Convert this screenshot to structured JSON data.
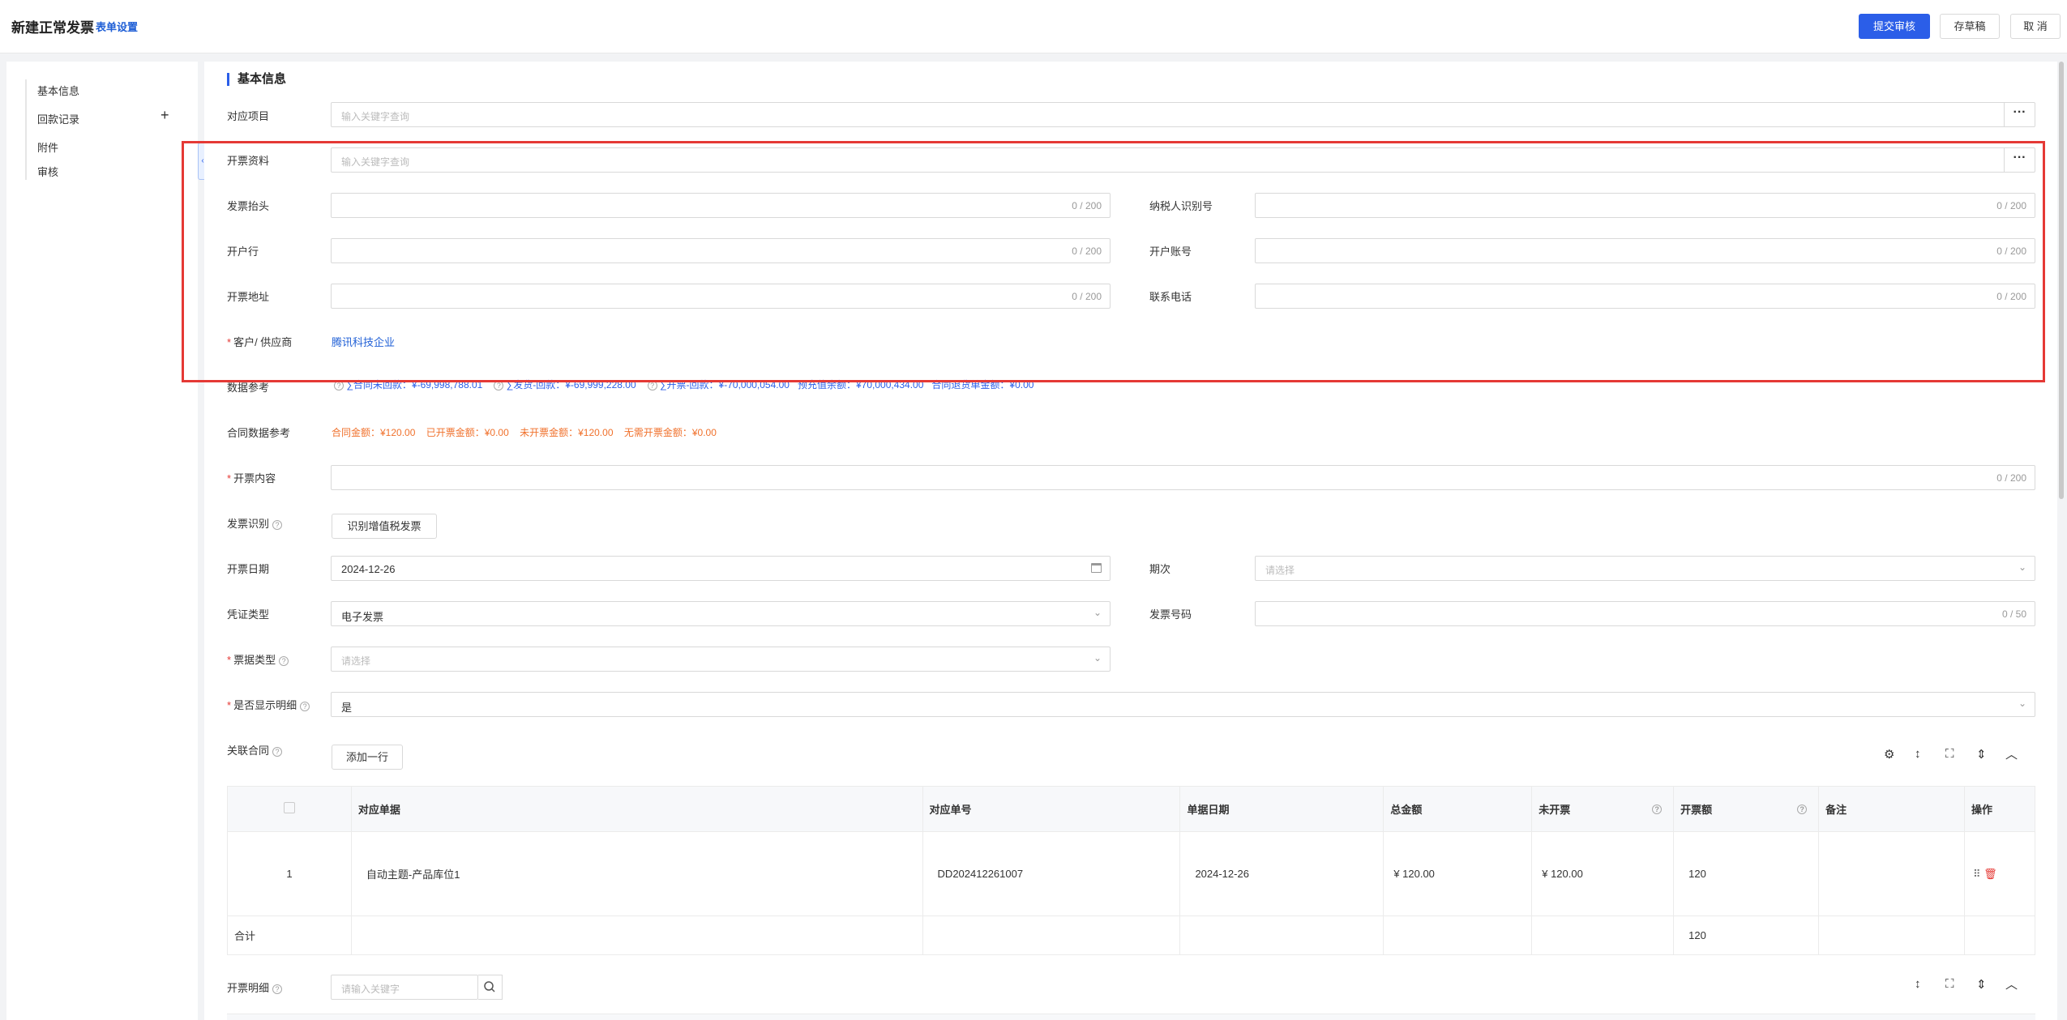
{
  "header": {
    "title": "新建正常发票",
    "form_settings": "表单设置",
    "submit": "提交审核",
    "draft": "存草稿",
    "cancel": "取 消"
  },
  "sidebar": {
    "items": [
      {
        "label": "基本信息"
      },
      {
        "label": "回款记录"
      },
      {
        "label": "附件"
      },
      {
        "label": "审核"
      }
    ]
  },
  "section": {
    "title": "基本信息"
  },
  "form": {
    "project": {
      "label": "对应项目",
      "placeholder": "输入关键字查询"
    },
    "invoice_info": {
      "label": "开票资料",
      "placeholder": "输入关键字查询"
    },
    "invoice_title": {
      "label": "发票抬头",
      "count": "0 / 200"
    },
    "taxpayer_id": {
      "label": "纳税人识别号",
      "count": "0 / 200"
    },
    "bank": {
      "label": "开户行",
      "count": "0 / 200"
    },
    "account": {
      "label": "开户账号",
      "count": "0 / 200"
    },
    "address": {
      "label": "开票地址",
      "count": "0 / 200"
    },
    "phone": {
      "label": "联系电话",
      "count": "0 / 200"
    },
    "customer": {
      "label": "客户/ 供应商",
      "value": "腾讯科技企业"
    },
    "data_ref": {
      "label": "数据参考",
      "items": [
        "∑合同未回款：¥-69,998,788.01",
        "∑发货-回款：¥-69,999,228.00",
        "∑开票-回款：¥-70,000,054.00",
        "预充值余额：¥70,000,434.00",
        "合同退货单金额：¥0.00"
      ]
    },
    "contract_ref": {
      "label": "合同数据参考",
      "items": [
        "合同金额：¥120.00",
        "已开票金额：¥0.00",
        "未开票金额：¥120.00",
        "无需开票金额：¥0.00"
      ]
    },
    "content": {
      "label": "开票内容",
      "count": "0 / 200"
    },
    "recognize": {
      "label": "发票识别",
      "button": "识别增值税发票"
    },
    "date": {
      "label": "开票日期",
      "value": "2024-12-26"
    },
    "period": {
      "label": "期次",
      "placeholder": "请选择"
    },
    "voucher_type": {
      "label": "凭证类型",
      "value": "电子发票"
    },
    "invoice_no": {
      "label": "发票号码",
      "count": "0 / 50"
    },
    "bill_type": {
      "label": "票据类型",
      "placeholder": "请选择"
    },
    "show_detail": {
      "label": "是否显示明细",
      "value": "是"
    },
    "related_contract": {
      "label": "关联合同",
      "button": "添加一行"
    }
  },
  "table": {
    "headers": [
      "对应单据",
      "对应单号",
      "单据日期",
      "总金额",
      "未开票",
      "开票额",
      "备注",
      "操作"
    ],
    "rows": [
      {
        "index": "1",
        "doc": "自动主题-产品库位1",
        "no": "DD202412261007",
        "date": "2024-12-26",
        "total": "¥ 120.00",
        "unbilled": "¥ 120.00",
        "amount": "120",
        "note": ""
      }
    ],
    "total_label": "合计",
    "total_amount": "120"
  },
  "detail": {
    "label": "开票明细",
    "placeholder": "请输入关键字"
  }
}
